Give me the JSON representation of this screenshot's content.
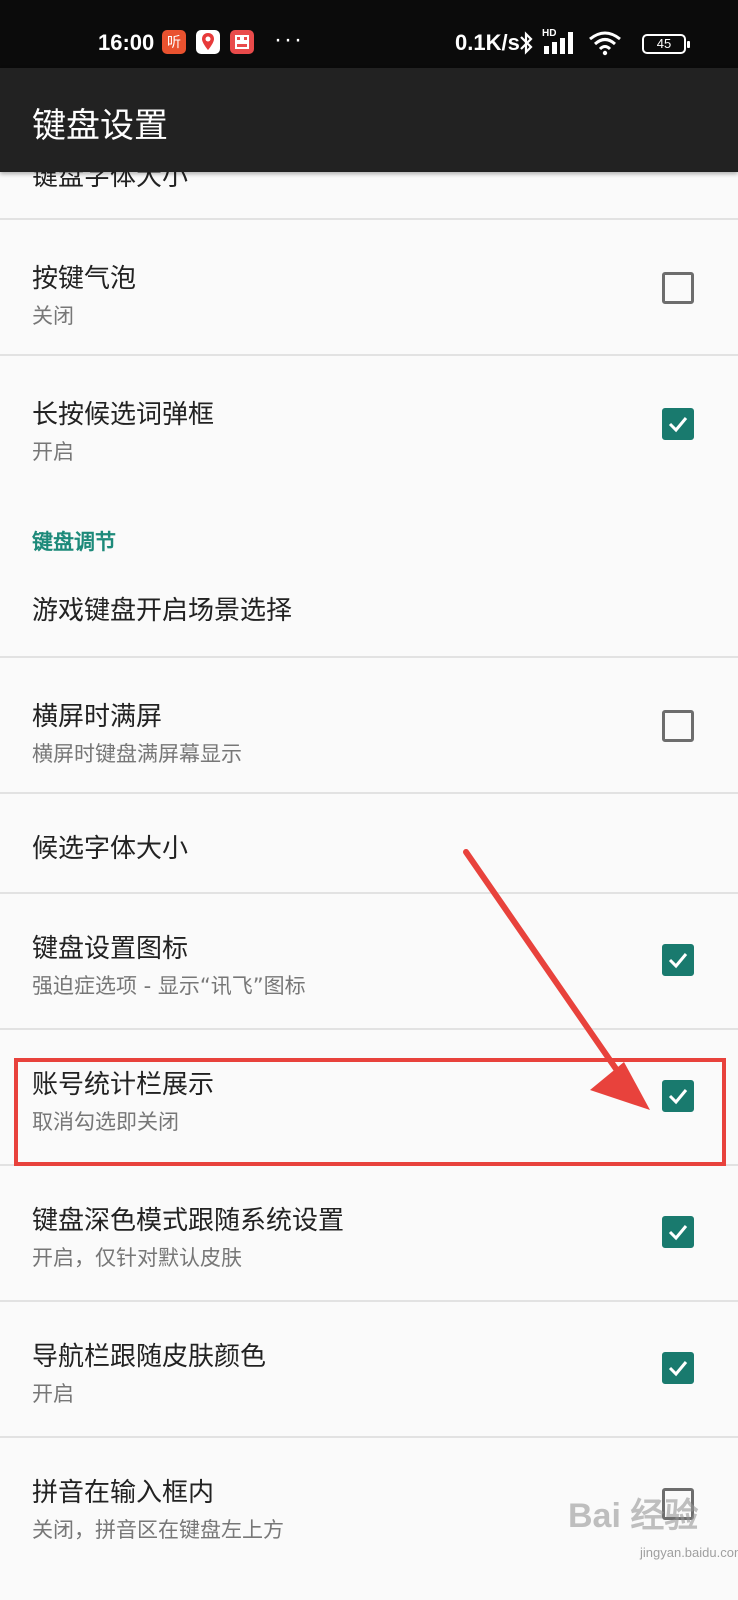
{
  "status_bar": {
    "time": "16:00",
    "app_icons": [
      {
        "icon": "ting-icon",
        "label": "听",
        "color": "#e9522f"
      },
      {
        "icon": "map-pin-icon",
        "label": "",
        "color": "#e73a3a"
      },
      {
        "icon": "app-icon",
        "label": "",
        "color": "#e94b4b"
      }
    ],
    "more": "···",
    "net_speed": "0.1K/s",
    "signal_label": "HD",
    "battery": "45"
  },
  "app_bar": {
    "title": "键盘设置"
  },
  "settings": {
    "partial_item": {
      "title": "键盘字体大小"
    },
    "items": [
      {
        "title": "按键气泡",
        "summary": "关闭",
        "checked": false
      },
      {
        "title": "长按候选词弹框",
        "summary": "开启",
        "checked": true
      }
    ],
    "section": {
      "label": "键盘调节"
    },
    "items2": [
      {
        "title": "游戏键盘开启场景选择"
      },
      {
        "title": "横屏时满屏",
        "summary": "横屏时键盘满屏幕显示",
        "checked": false
      },
      {
        "title": "候选字体大小"
      },
      {
        "title": "键盘设置图标",
        "summary": "强迫症选项 - 显示“讯飞”图标",
        "checked": true
      },
      {
        "title": "账号统计栏展示",
        "summary": "取消勾选即关闭",
        "checked": true
      },
      {
        "title": "键盘深色模式跟随系统设置",
        "summary": "开启，仅针对默认皮肤",
        "checked": true
      },
      {
        "title": "导航栏跟随皮肤颜色",
        "summary": "开启",
        "checked": true
      },
      {
        "title": "拼音在输入框内",
        "summary": "关闭，拼音区在键盘左上方",
        "checked": false
      }
    ]
  },
  "colors": {
    "accent": "#197a6e",
    "section": "#1d8a7a",
    "annotation": "#e8423c"
  },
  "watermark": {
    "text": "Bai 经验",
    "url": "jingyan.baidu.com"
  }
}
